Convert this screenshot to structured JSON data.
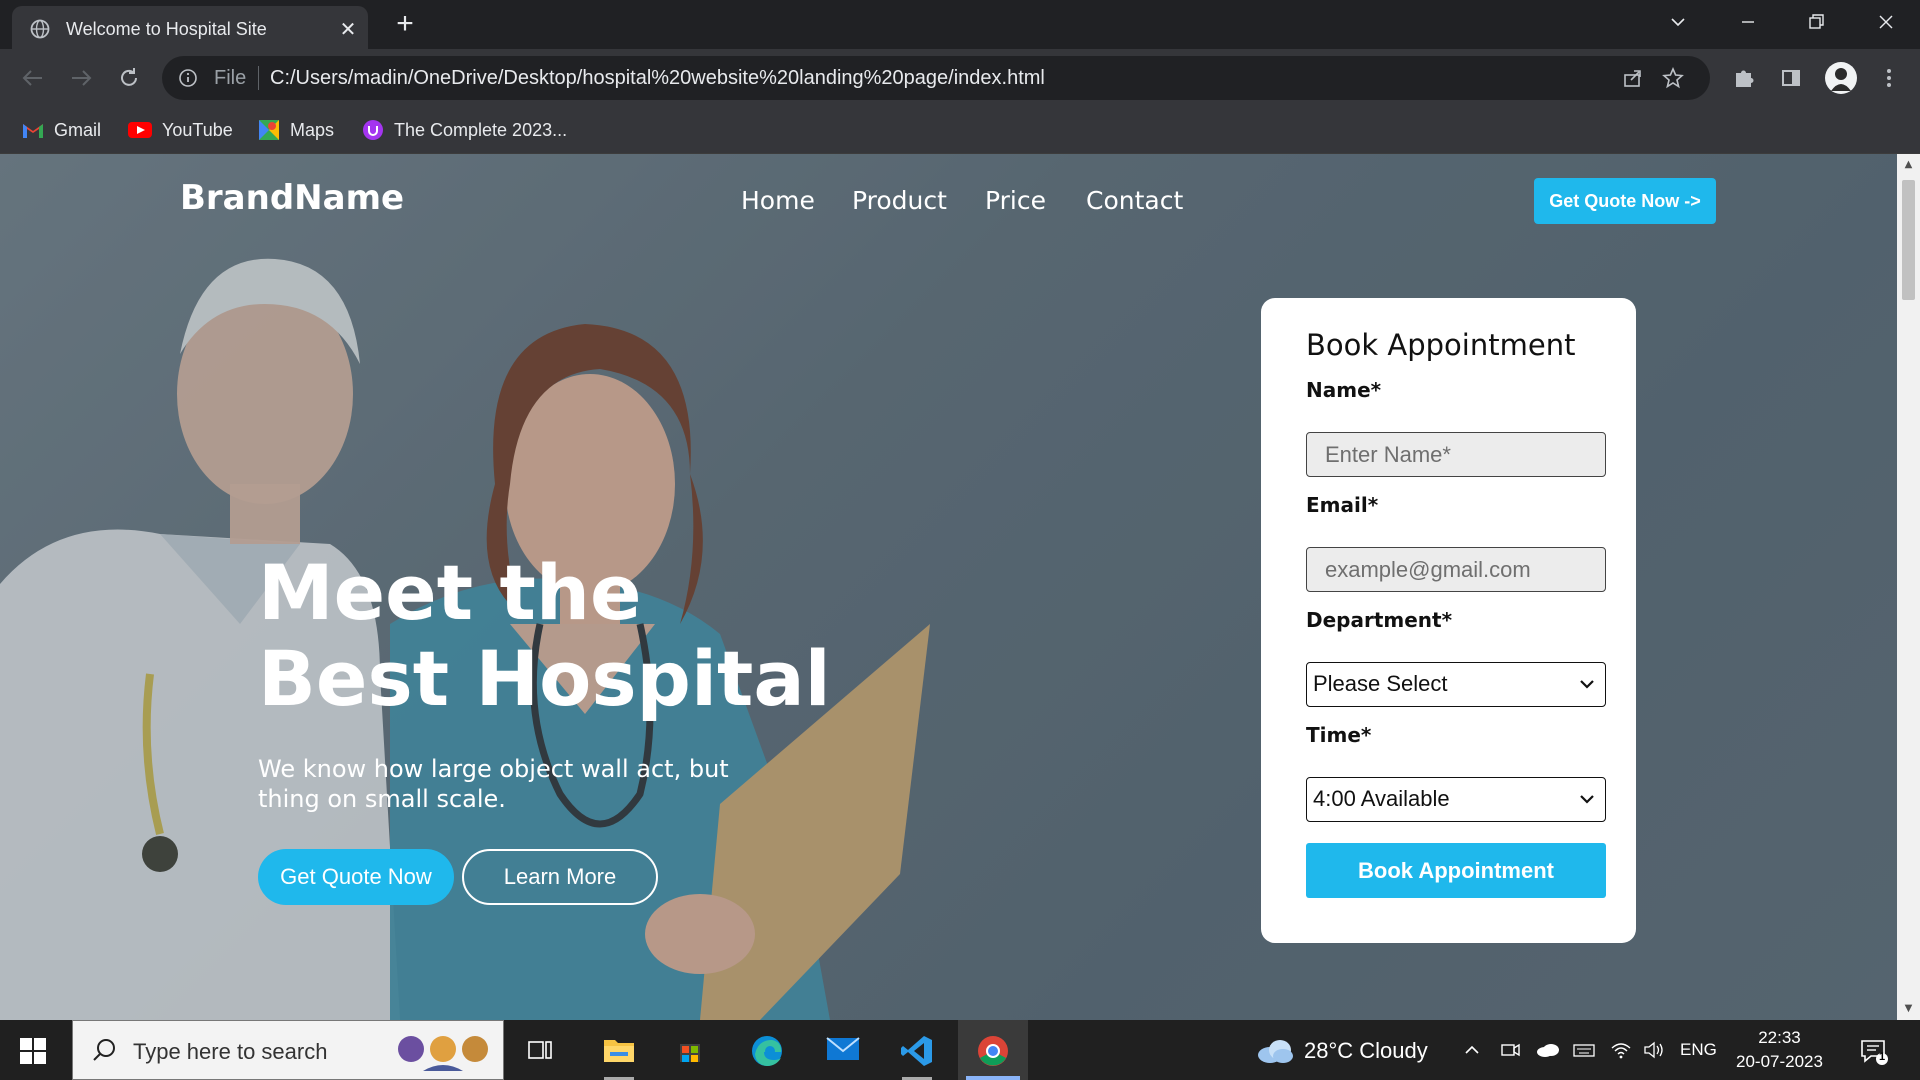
{
  "browser": {
    "tab_title": "Welcome to Hospital Site",
    "tab_close": "✕",
    "new_tab": "+",
    "scheme": "File",
    "url": "C:/Users/madin/OneDrive/Desktop/hospital%20website%20landing%20page/index.html",
    "bookmarks": [
      {
        "label": "Gmail",
        "icon": "gmail-icon"
      },
      {
        "label": "YouTube",
        "icon": "youtube-icon"
      },
      {
        "label": "Maps",
        "icon": "maps-icon"
      },
      {
        "label": "The Complete 2023...",
        "icon": "udemy-icon"
      }
    ]
  },
  "site": {
    "brand": "BrandName",
    "nav": [
      "Home",
      "Product",
      "Price",
      "Contact"
    ],
    "cta_top": "Get Quote Now ->",
    "hero_title": "Meet the Best Hospital",
    "hero_subtitle": "We know how large object wall act, but thing on small scale.",
    "btn_primary": "Get Quote Now",
    "btn_secondary": "Learn More"
  },
  "form": {
    "title": "Book Appointment",
    "name_label": "Name*",
    "name_placeholder": "Enter Name*",
    "email_label": "Email*",
    "email_placeholder": "example@gmail.com",
    "department_label": "Department*",
    "department_value": "Please Select",
    "time_label": "Time*",
    "time_value": "4:00 Available",
    "submit": "Book Appointment"
  },
  "taskbar": {
    "search_placeholder": "Type here to search",
    "weather": "28°C  Cloudy",
    "lang": "ENG",
    "time": "22:33",
    "date": "20-07-2023",
    "notifications": "1"
  },
  "colors": {
    "accent": "#1fb8ec",
    "chrome_dark": "#202124",
    "chrome_mid": "#35363a"
  }
}
